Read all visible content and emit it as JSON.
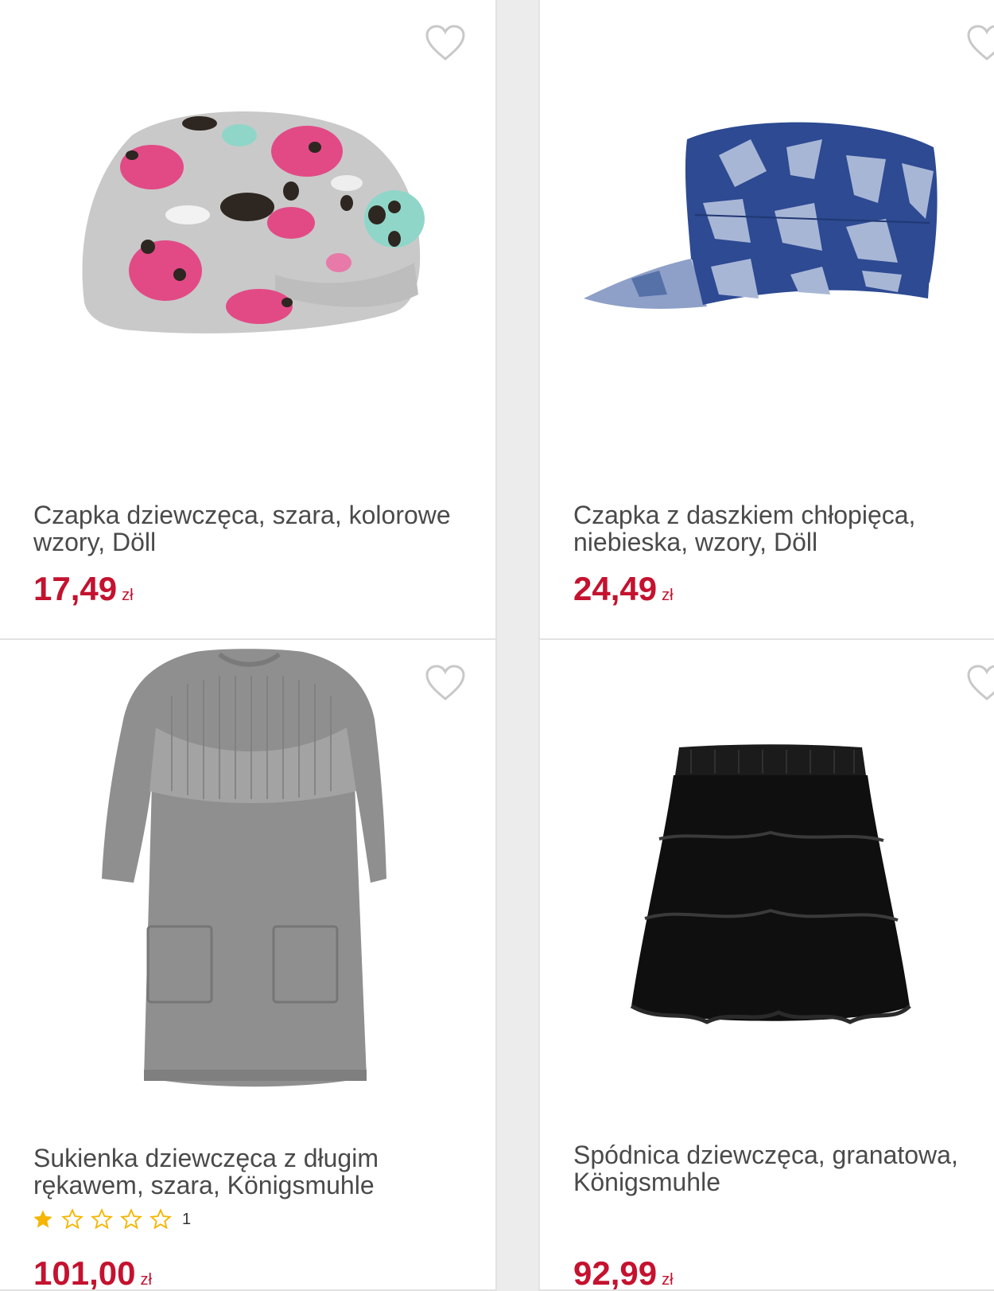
{
  "products": [
    {
      "title": "Czapka dziewczęca, szara, kolorowe wzory, Döll",
      "price": "17,49",
      "currency": "zł",
      "image": "grey-patterned-girls-beanie",
      "favorite_icon": "heart-outline-icon"
    },
    {
      "title": "Czapka z daszkiem chłopięca, niebieska, wzory, Döll",
      "price": "24,49",
      "currency": "zł",
      "image": "blue-camo-peaked-cap",
      "favorite_icon": "heart-outline-icon"
    },
    {
      "title": "Sukienka dziewczęca z długim rękawem, szara, Königsmuhle",
      "price": "101,00",
      "currency": "zł",
      "rating": {
        "stars": 1,
        "max": 5,
        "count": "1"
      },
      "image": "grey-knit-long-sleeve-dress",
      "favorite_icon": "heart-outline-icon"
    },
    {
      "title": "Spódnica dziewczęca, granatowa, Königsmuhle",
      "price": "92,99",
      "currency": "zł",
      "image": "black-tiered-tulle-skirt",
      "favorite_icon": "heart-outline-icon"
    }
  ],
  "colors": {
    "price": "#c4122f",
    "star": "#f5b500",
    "heart": "#c8c8c8",
    "card_border": "#e2e2e2"
  }
}
